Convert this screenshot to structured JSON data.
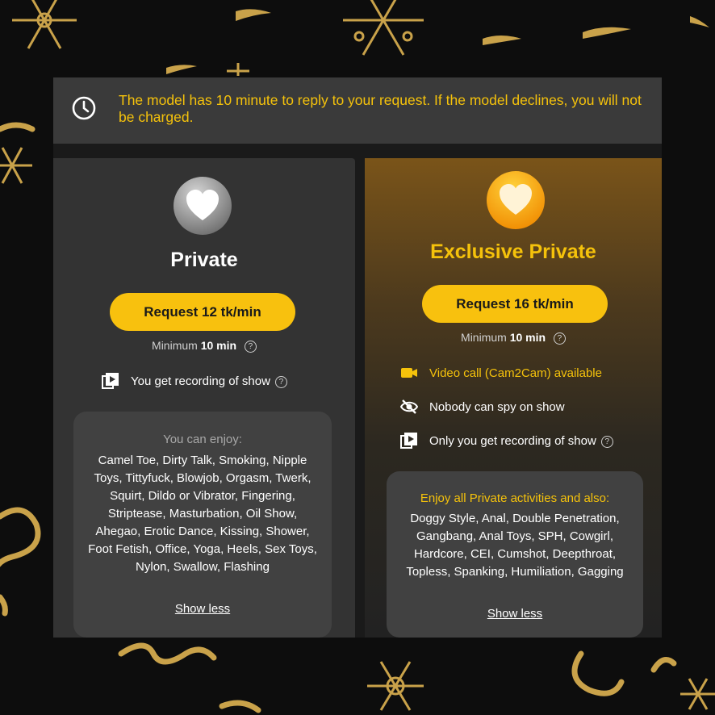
{
  "banner": {
    "text": "The model has 10 minute to reply to your request. If the model declines, you will not be charged."
  },
  "private": {
    "title": "Private",
    "request_label": "Request 12 tk/min",
    "minimum_prefix": "Minimum",
    "minimum_value": "10 min",
    "features": [
      {
        "icon": "recording-icon",
        "text": "You get recording of show"
      }
    ],
    "enjoy_heading": "You can enjoy:",
    "enjoy_list": "Camel Toe, Dirty Talk, Smoking, Nipple Toys, Tittyfuck, Blowjob, Orgasm, Twerk, Squirt, Dildo or Vibrator, Fingering, Striptease, Masturbation, Oil Show, Ahegao, Erotic Dance, Kissing, Shower, Foot Fetish, Office, Yoga, Heels, Sex Toys, Nylon, Swallow, Flashing",
    "show_less": "Show less"
  },
  "exclusive": {
    "title": "Exclusive Private",
    "request_label": "Request 16 tk/min",
    "minimum_prefix": "Minimum",
    "minimum_value": "10 min",
    "features": [
      {
        "icon": "video-camera-icon",
        "text": "Video call (Cam2Cam) available"
      },
      {
        "icon": "eye-slash-icon",
        "text": "Nobody can spy on show"
      },
      {
        "icon": "recording-icon",
        "text": "Only you get recording of show"
      }
    ],
    "enjoy_heading": "Enjoy all Private activities and also:",
    "enjoy_list": "Doggy Style, Anal, Double Penetration, Gangbang, Anal Toys, SPH, Cowgirl, Hardcore, CEI, Cumshot, Deepthroat, Topless, Spanking, Humiliation, Gagging",
    "show_less": "Show less"
  },
  "colors": {
    "accent_yellow": "#f8c10e",
    "banner_bg": "#3a3a3a",
    "private_card_bg": "#333333",
    "exclusive_gold": "#7a5419",
    "title_gold": "#f5c20b"
  }
}
